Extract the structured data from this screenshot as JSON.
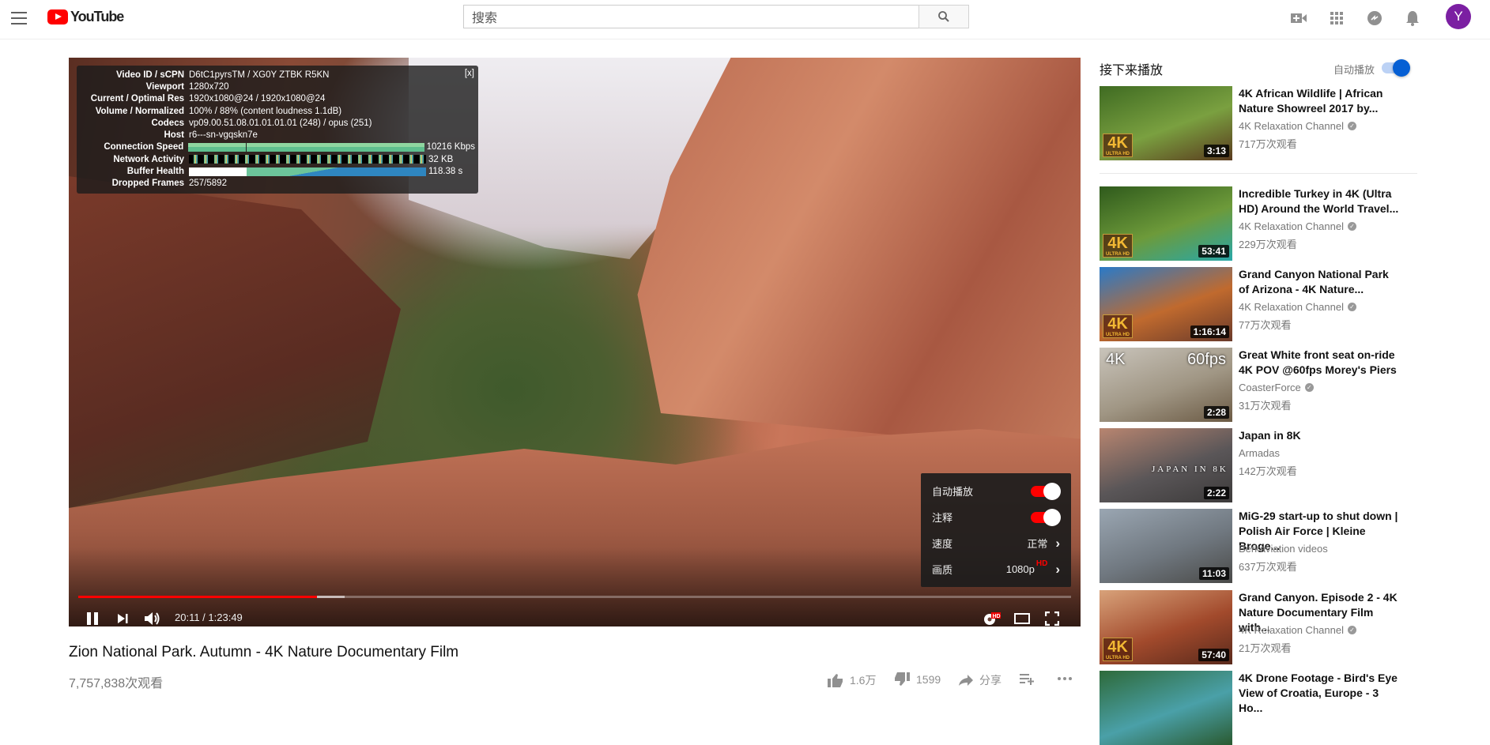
{
  "header": {
    "logo_text": "YouTube",
    "search_placeholder": "搜索",
    "avatar_letter": "Y"
  },
  "stats": {
    "close": "[x]",
    "rows": [
      {
        "k": "Video ID / sCPN",
        "v": "D6tC1pyrsTM / XG0Y ZTBK R5KN"
      },
      {
        "k": "Viewport",
        "v": "1280x720"
      },
      {
        "k": "Current / Optimal Res",
        "v": "1920x1080@24 / 1920x1080@24"
      },
      {
        "k": "Volume / Normalized",
        "v": "100% / 88% (content loudness 1.1dB)"
      },
      {
        "k": "Codecs",
        "v": "vp09.00.51.08.01.01.01.01 (248) / opus (251)"
      },
      {
        "k": "Host",
        "v": "r6---sn-vgqskn7e"
      },
      {
        "k": "Connection Speed",
        "v": "10216 Kbps"
      },
      {
        "k": "Network Activity",
        "v": "32 KB"
      },
      {
        "k": "Buffer Health",
        "v": "118.38 s"
      },
      {
        "k": "Dropped Frames",
        "v": "257/5892"
      }
    ]
  },
  "player": {
    "time": "20:11 / 1:23:49",
    "progress_fraction": 0.2407,
    "buffered_fraction": 0.268,
    "hd_badge": "HD",
    "menu": [
      {
        "label": "自动播放",
        "toggle": true
      },
      {
        "label": "注释",
        "toggle": true
      },
      {
        "label": "速度",
        "value": "正常"
      },
      {
        "label": "画质",
        "value": "1080p",
        "sup": "HD"
      }
    ]
  },
  "video": {
    "title": "Zion National Park. Autumn - 4K Nature Documentary Film",
    "views": "7,757,838次观看",
    "likes": "1.6万",
    "dislikes": "1599",
    "share": "分享"
  },
  "sidebar": {
    "heading": "接下来播放",
    "autoplay_label": "自动播放",
    "items": [
      {
        "title": "4K African Wildlife | African Nature Showreel 2017 by...",
        "channel": "4K Relaxation Channel",
        "verified": true,
        "views": "717万次观看",
        "duration": "3:13",
        "badge": "4K",
        "colors": [
          "#3f6b22",
          "#7aa040",
          "#5a3a1e"
        ]
      },
      {
        "title": "Incredible Turkey in 4K (Ultra HD) Around the World Travel...",
        "channel": "4K Relaxation Channel",
        "verified": true,
        "views": "229万次观看",
        "duration": "53:41",
        "badge": "4K",
        "colors": [
          "#2f5a1c",
          "#6d9a3a",
          "#28a8a8"
        ]
      },
      {
        "title": "Grand Canyon National Park of Arizona - 4K Nature...",
        "channel": "4K Relaxation Channel",
        "verified": true,
        "views": "77万次观看",
        "duration": "1:16:14",
        "badge": "4K",
        "colors": [
          "#2a7ac8",
          "#c06a2e",
          "#6a3a2a"
        ]
      },
      {
        "title": "Great White front seat on-ride 4K POV @60fps Morey's Piers",
        "channel": "CoasterForce",
        "verified": true,
        "views": "31万次观看",
        "duration": "2:28",
        "overlay_left": "4K",
        "overlay_right": "60fps",
        "colors": [
          "#c9c4bb",
          "#a09684",
          "#6b5a44"
        ]
      },
      {
        "title": "Japan in 8K",
        "channel": "Armadas",
        "verified": false,
        "views": "142万次观看",
        "duration": "2:22",
        "overlay_center": "JAPAN IN 8K",
        "colors": [
          "#b88570",
          "#5a5658",
          "#3c3a3a"
        ]
      },
      {
        "title": "MiG-29 start-up to shut down | Polish Air Force | Kleine Broge...",
        "channel": "Berkaviation videos",
        "verified": false,
        "views": "637万次观看",
        "duration": "11:03",
        "colors": [
          "#9aa6b2",
          "#707880",
          "#4a4a48"
        ]
      },
      {
        "title": "Grand Canyon. Episode 2 - 4K Nature Documentary Film with...",
        "channel": "4K Relaxation Channel",
        "verified": true,
        "views": "21万次观看",
        "duration": "57:40",
        "badge": "4K",
        "colors": [
          "#d8a27a",
          "#a24a2c",
          "#5a2a1c"
        ]
      },
      {
        "title": "4K Drone Footage - Bird's Eye View of Croatia, Europe - 3 Ho...",
        "colors": [
          "#2e6a3a",
          "#4aa0a8",
          "#2a5a30"
        ]
      }
    ]
  }
}
